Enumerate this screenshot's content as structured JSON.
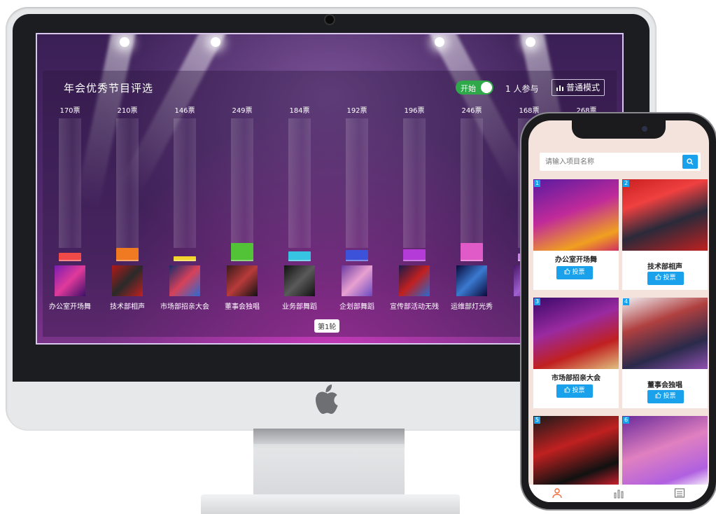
{
  "desktop": {
    "title": "年会优秀节目评选",
    "toggle_label": "开始",
    "participants": "1 人参与",
    "mode_button": "普通模式",
    "round_label": "第1轮",
    "programs": [
      {
        "name": "办公室开场舞",
        "votes": "170票",
        "value": 170,
        "color": "#ef4a48"
      },
      {
        "name": "技术部相声",
        "votes": "210票",
        "value": 210,
        "color": "#f07a22"
      },
      {
        "name": "市场部招亲大会",
        "votes": "146票",
        "value": 146,
        "color": "#f3d42c"
      },
      {
        "name": "董事会独唱",
        "votes": "249票",
        "value": 249,
        "color": "#52c236"
      },
      {
        "name": "业务部舞蹈",
        "votes": "184票",
        "value": 184,
        "color": "#37c4e3"
      },
      {
        "name": "企划部舞蹈",
        "votes": "192票",
        "value": 192,
        "color": "#3c52d8"
      },
      {
        "name": "宣传部活动无残",
        "votes": "196票",
        "value": 196,
        "color": "#b43bd7"
      },
      {
        "name": "运维部灯光秀",
        "votes": "246票",
        "value": 246,
        "color": "#e05bc8"
      },
      {
        "name": "业",
        "votes": "168票",
        "value": 168,
        "color": "#c78ae0"
      },
      {
        "name": "",
        "votes": "268票",
        "value": 268,
        "color": "#9a66e6"
      }
    ]
  },
  "mobile": {
    "search_placeholder": "请输入项目名称",
    "vote_label": "投票",
    "cards": [
      {
        "num": "1",
        "title": "办公室开场舞"
      },
      {
        "num": "2",
        "title": "技术部相声"
      },
      {
        "num": "3",
        "title": "市场部招亲大会"
      },
      {
        "num": "4",
        "title": "董事会独唱"
      },
      {
        "num": "5",
        "title": ""
      },
      {
        "num": "6",
        "title": ""
      }
    ]
  }
}
